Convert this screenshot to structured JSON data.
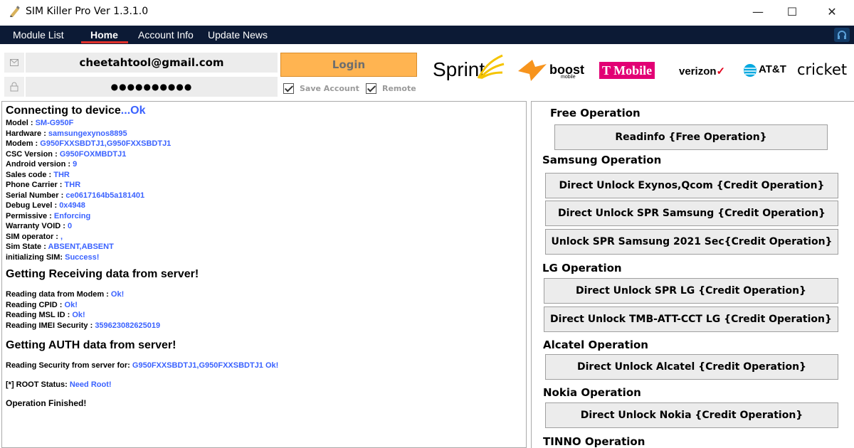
{
  "window": {
    "title": "SIM Killer Pro Ver 1.3.1.0",
    "minimize_glyph": "—",
    "maximize_glyph": "☐",
    "close_glyph": "✕",
    "app_icon": "pen-tag-icon"
  },
  "menu": {
    "items": [
      {
        "label": "Module List"
      },
      {
        "label": "Home"
      },
      {
        "label": "Account Info"
      },
      {
        "label": "Update News"
      }
    ],
    "active": "Home",
    "accent_color": "#e0302a",
    "bg_color": "#0c1a35"
  },
  "login": {
    "email": "cheetahtool@gmail.com",
    "password": "●●●●●●●●●●",
    "email_icon": "envelope-icon",
    "password_icon": "lock-icon",
    "login_label": "Login",
    "save_account_label": "Save Account",
    "remote_label": "Remote",
    "save_account_checked": true,
    "remote_checked": true
  },
  "carriers": {
    "sprint": "Sprint",
    "boost": "boost",
    "boost_sub": "mobile",
    "tmobile": "T Mobile",
    "verizon": "verizon",
    "att": "AT&T",
    "cricket": "cricket"
  },
  "log": {
    "connecting": {
      "label": "Connecting to device",
      "value": "...Ok"
    },
    "device_info": [
      {
        "label": "Model",
        "value": "SM-G950F"
      },
      {
        "label": "Hardware",
        "value": "samsungexynos8895"
      },
      {
        "label": "Modem",
        "value": "G950FXXSBDTJ1,G950FXXSBDTJ1"
      },
      {
        "label": "CSC Version",
        "value": "G950FOXMBDTJ1"
      },
      {
        "label": "Android version",
        "value": "9"
      },
      {
        "label": "Sales code",
        "value": "THR"
      },
      {
        "label": "Phone Carrier",
        "value": "THR"
      },
      {
        "label": "Serial Number",
        "value": "ce0617164b5a181401"
      },
      {
        "label": "Debug Level",
        "value": "0x4948"
      },
      {
        "label": "Permissive",
        "value": "Enforcing"
      },
      {
        "label": "Warranty VOID",
        "value": "0"
      },
      {
        "label": "SIM operator",
        "value": ","
      },
      {
        "label": "Sim State",
        "value": "ABSENT,ABSENT"
      }
    ],
    "init_sim": {
      "label": "initializing SIM",
      "value": "Success!"
    },
    "receiving_heading": "Getting Receiving data from server!",
    "reading": [
      {
        "label": "Reading data from Modem",
        "value": "Ok!"
      },
      {
        "label": "Reading CPID",
        "value": "Ok!"
      },
      {
        "label": "Reading MSL ID",
        "value": "Ok!"
      },
      {
        "label": "Reading IMEI Security",
        "value": "359623082625019"
      }
    ],
    "auth_heading": "Getting AUTH data from server!",
    "security": {
      "label": "Reading Security from server for",
      "value": "G950FXXSBDTJ1,G950FXXSBDTJ1 Ok!"
    },
    "root": {
      "label": "[*] ROOT Status",
      "value": "Need Root!"
    },
    "finished": "Operation Finished!"
  },
  "operations": {
    "free_head": "Free Operation",
    "free_readinfo": "Readinfo {Free Operation}",
    "samsung_head": "Samsung Operation",
    "samsung_exynos": "Direct Unlock Exynos,Qcom {Credit Operation}",
    "samsung_spr": "Direct Unlock SPR Samsung {Credit Operation}",
    "samsung_2021": "Unlock SPR Samsung 2021 Sec{Credit Operation}",
    "lg_head": "LG Operation",
    "lg_spr": "Direct Unlock SPR LG {Credit Operation}",
    "lg_tmb": "Direct Unlock TMB-ATT-CCT LG {Credit Operation}",
    "alcatel_head": "Alcatel Operation",
    "alcatel_unlock": "Direct Unlock Alcatel {Credit Operation}",
    "nokia_head": "Nokia Operation",
    "nokia_unlock": "Direct Unlock Nokia {Credit Operation}",
    "tinno_head": "TINNO Operation"
  }
}
